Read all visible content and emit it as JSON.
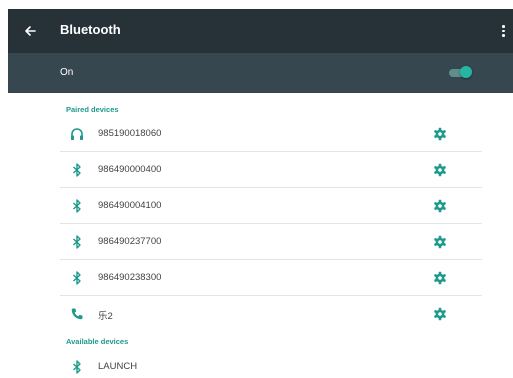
{
  "appbar": {
    "title": "Bluetooth",
    "back_icon": "arrow-back-icon",
    "menu_icon": "more-vert-icon"
  },
  "switch": {
    "label": "On",
    "state": "on",
    "accent": "#26b5a3"
  },
  "paired": {
    "header": "Paired devices",
    "devices": [
      {
        "name": "985190018060",
        "icon": "headphones-icon"
      },
      {
        "name": "986490000400",
        "icon": "bluetooth-icon"
      },
      {
        "name": "986490004100",
        "icon": "bluetooth-icon"
      },
      {
        "name": "986490237700",
        "icon": "bluetooth-icon"
      },
      {
        "name": "986490238300",
        "icon": "bluetooth-icon"
      },
      {
        "name": "乐2",
        "icon": "phone-icon"
      }
    ]
  },
  "available": {
    "header": "Available devices",
    "devices": [
      {
        "name": "LAUNCH",
        "icon": "bluetooth-icon"
      }
    ]
  },
  "colors": {
    "appbar": "#263238",
    "switchbar": "#37474f",
    "accent": "#1e9a8a"
  }
}
